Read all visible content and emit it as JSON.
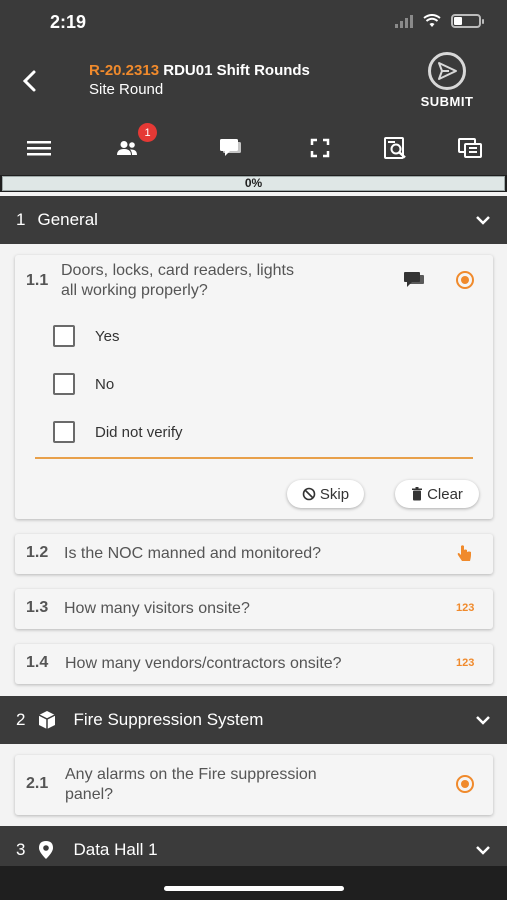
{
  "status_bar": {
    "time": "2:19"
  },
  "header": {
    "round_id": "R-20.2313",
    "round_title": "RDU01 Shift Rounds",
    "subtitle": "Site Round",
    "submit_label": "SUBMIT"
  },
  "toolbar": {
    "participants_badge": "1"
  },
  "progress": {
    "label": "0%",
    "value": 0
  },
  "sections": [
    {
      "number": "1",
      "title": "General"
    },
    {
      "number": "2",
      "title": "Fire Suppression System"
    },
    {
      "number": "3",
      "title": "Data Hall 1"
    }
  ],
  "questions": [
    {
      "number": "1.1",
      "text_line1": "Doors, locks, card readers, lights",
      "text_line2": "all working properly?"
    },
    {
      "number": "1.2",
      "text": "Is the NOC manned and monitored?"
    },
    {
      "number": "1.3",
      "text": "How many visitors onsite?"
    },
    {
      "number": "1.4",
      "text": "How many vendors/contractors onsite?"
    },
    {
      "number": "2.1",
      "text_line1": "Any alarms on the Fire suppression",
      "text_line2": "panel?"
    }
  ],
  "options": [
    "Yes",
    "No",
    "Did not verify"
  ],
  "actions": {
    "skip": "Skip",
    "clear": "Clear"
  },
  "number_type_label": "123",
  "colors": {
    "accent": "#f08a2c",
    "header_bg": "#3a3a3a",
    "section_bg": "#3b3b3b"
  }
}
